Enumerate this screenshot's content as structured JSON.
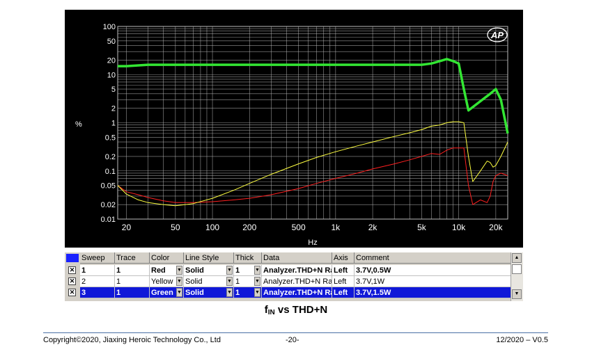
{
  "chart_data": {
    "type": "line",
    "ylabel": "%",
    "xlabel": "Hz",
    "x_scale": "log",
    "y_scale": "log",
    "xlim": [
      17,
      25000
    ],
    "ylim": [
      0.01,
      100
    ],
    "grid": true,
    "x_ticks": [
      {
        "v": 20,
        "label": "20"
      },
      {
        "v": 50,
        "label": "50"
      },
      {
        "v": 100,
        "label": "100"
      },
      {
        "v": 200,
        "label": "200"
      },
      {
        "v": 500,
        "label": "500"
      },
      {
        "v": 1000,
        "label": "1k"
      },
      {
        "v": 2000,
        "label": "2k"
      },
      {
        "v": 5000,
        "label": "5k"
      },
      {
        "v": 10000,
        "label": "10k"
      },
      {
        "v": 20000,
        "label": "20k"
      }
    ],
    "y_ticks": [
      {
        "v": 100,
        "label": "100"
      },
      {
        "v": 50,
        "label": "50"
      },
      {
        "v": 20,
        "label": "20"
      },
      {
        "v": 10,
        "label": "10"
      },
      {
        "v": 5,
        "label": "5"
      },
      {
        "v": 2,
        "label": "2"
      },
      {
        "v": 1,
        "label": "1"
      },
      {
        "v": 0.5,
        "label": "0.5"
      },
      {
        "v": 0.2,
        "label": "0.2"
      },
      {
        "v": 0.1,
        "label": "0.1"
      },
      {
        "v": 0.05,
        "label": "0.05"
      },
      {
        "v": 0.02,
        "label": "0.02"
      },
      {
        "v": 0.01,
        "label": "0.01"
      }
    ],
    "series": [
      {
        "name": "3.7V,0.5W",
        "color": "#ff2020",
        "width": 1,
        "x": [
          17,
          20,
          25,
          30,
          40,
          50,
          60,
          70,
          100,
          150,
          200,
          300,
          500,
          700,
          1000,
          1500,
          2000,
          3000,
          4000,
          5000,
          6000,
          7000,
          8000,
          9000,
          10000,
          11000,
          12000,
          13000,
          15000,
          17000,
          18000,
          19000,
          20000,
          22000,
          25000
        ],
        "y": [
          0.05,
          0.037,
          0.032,
          0.028,
          0.024,
          0.022,
          0.022,
          0.022,
          0.023,
          0.025,
          0.027,
          0.032,
          0.043,
          0.055,
          0.07,
          0.09,
          0.11,
          0.14,
          0.17,
          0.2,
          0.23,
          0.22,
          0.27,
          0.3,
          0.3,
          0.3,
          0.05,
          0.02,
          0.025,
          0.022,
          0.03,
          0.06,
          0.08,
          0.09,
          0.08
        ]
      },
      {
        "name": "3.7V,1W",
        "color": "#ffff40",
        "width": 1,
        "x": [
          17,
          20,
          25,
          30,
          40,
          50,
          60,
          70,
          100,
          150,
          200,
          300,
          500,
          700,
          1000,
          1500,
          2000,
          3000,
          4000,
          5000,
          6000,
          7000,
          8000,
          9000,
          10000,
          11000,
          12000,
          13000,
          15000,
          17000,
          18000,
          19000,
          20000,
          22000,
          25000
        ],
        "y": [
          0.05,
          0.033,
          0.025,
          0.022,
          0.02,
          0.019,
          0.02,
          0.021,
          0.027,
          0.04,
          0.055,
          0.085,
          0.14,
          0.19,
          0.25,
          0.33,
          0.4,
          0.52,
          0.62,
          0.72,
          0.85,
          0.9,
          1.0,
          1.05,
          1.05,
          1.0,
          0.2,
          0.06,
          0.1,
          0.16,
          0.15,
          0.12,
          0.13,
          0.2,
          0.4
        ]
      },
      {
        "name": "3.7V,1.5W",
        "color": "#33e633",
        "width": 3.5,
        "x": [
          17,
          20,
          30,
          40,
          60,
          100,
          200,
          500,
          1000,
          2000,
          5000,
          6000,
          7000,
          8000,
          9000,
          10000,
          11000,
          12000,
          15000,
          18000,
          20000,
          22000,
          25000
        ],
        "y": [
          15,
          15,
          16,
          16,
          16,
          16,
          16,
          16,
          16,
          16,
          16,
          17,
          19,
          21,
          19,
          17,
          5,
          1.8,
          2.8,
          4,
          5,
          3,
          0.6
        ]
      }
    ]
  },
  "y_axis_title": "%",
  "x_axis_title": "Hz",
  "logo_text": "AP",
  "table": {
    "headers": [
      "Sweep",
      "Trace",
      "Color",
      "Line Style",
      "Thick",
      "Data",
      "Axis",
      "Comment"
    ],
    "rows": [
      {
        "checked": "✕",
        "sweep": "1",
        "trace": "1",
        "color": "Red",
        "style": "Solid",
        "thick": "1",
        "data": "Analyzer.THD+N Ratio",
        "axis": "Left",
        "comment": "3.7V,0.5W",
        "selected": false,
        "bold": true
      },
      {
        "checked": "✕",
        "sweep": "2",
        "trace": "1",
        "color": "Yellow",
        "style": "Solid",
        "thick": "1",
        "data": "Analyzer.THD+N Ratio",
        "axis": "Left",
        "comment": "3.7V,1W",
        "selected": false,
        "bold": false
      },
      {
        "checked": "✕",
        "sweep": "3",
        "trace": "1",
        "color": "Green",
        "style": "Solid",
        "thick": "1",
        "data": "Analyzer.THD+N Ratio",
        "axis": "Left",
        "comment": "3.7V,1.5W",
        "selected": true,
        "bold": true
      }
    ]
  },
  "caption": {
    "main": "f",
    "sub": "IN",
    "rest": " vs THD+N"
  },
  "footer": {
    "copyright": "Copyright©2020, Jiaxing Heroic Technology Co., Ltd",
    "page": "-20-",
    "version": "12/2020 – V0.5"
  },
  "colors": {
    "background": "#000000",
    "grid": "#bdbdbd",
    "table_selected": "#1018d8"
  }
}
